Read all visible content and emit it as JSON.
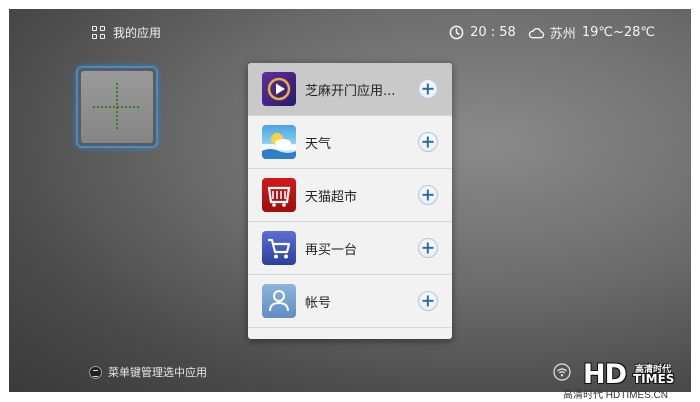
{
  "header": {
    "app_section_title": "我的应用",
    "time": "20 : 58",
    "city": "苏州",
    "temperature": "19℃~28℃"
  },
  "add_tile": {
    "icon": "plus-icon"
  },
  "app_list": {
    "items": [
      {
        "label": "芝麻开门应用...",
        "icon": "play-app-icon",
        "action_icon": "plus-icon",
        "selected": true
      },
      {
        "label": "天气",
        "icon": "weather-app-icon",
        "action_icon": "plus-icon",
        "selected": false
      },
      {
        "label": "天猫超市",
        "icon": "tmall-supermarket-icon",
        "action_icon": "plus-icon",
        "selected": false
      },
      {
        "label": "再买一台",
        "icon": "shopping-cart-icon",
        "action_icon": "plus-icon",
        "selected": false
      },
      {
        "label": "帐号",
        "icon": "account-icon",
        "action_icon": "plus-icon",
        "selected": false
      }
    ]
  },
  "footer": {
    "hint": "菜单键管理选中应用"
  },
  "watermark": {
    "logo_text": "HD",
    "cn_text": "高清时代",
    "times_text": "TIMES",
    "caption": "高清时代 HDTIMES.CN"
  },
  "colors": {
    "focus_border": "#3c8fd0",
    "plus_blue": "#2a6ab3",
    "selected_row": "#c9c9c9"
  }
}
